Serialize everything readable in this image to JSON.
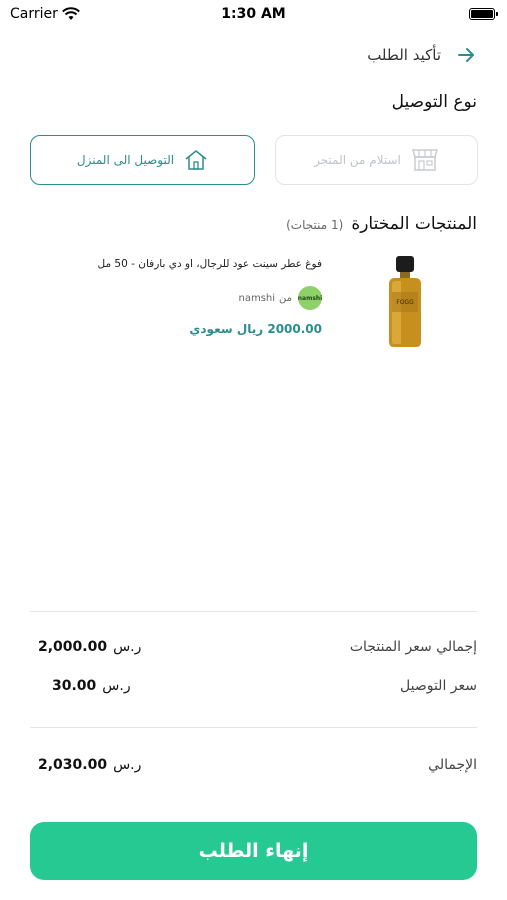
{
  "status_bar": {
    "carrier": "Carrier",
    "time": "1:30 AM"
  },
  "header": {
    "title": "تأكيد الطلب",
    "back_icon": "arrow-right-icon"
  },
  "delivery": {
    "title": "نوع التوصيل",
    "options": [
      {
        "label": "استلام من المتجر",
        "icon": "store-icon",
        "selected": false
      },
      {
        "label": "التوصيل الى المنزل",
        "icon": "home-icon",
        "selected": true
      }
    ]
  },
  "products": {
    "title": "المنتجات المختارة",
    "count": "(1 منتجات)",
    "items": [
      {
        "name": "فوغ عطر سينت عود للرجال، او دي بارفان - 50 مل",
        "store_from": "من",
        "store_name": "namshi",
        "store_logo_text": "namshi",
        "price": "2000.00 ريال سعودي",
        "image_label": "FOGG"
      }
    ]
  },
  "summary": {
    "products_total_label": "إجمالي سعر المنتجات",
    "products_total_value": "2,000.00",
    "delivery_label": "سعر التوصيل",
    "delivery_value": "30.00",
    "total_label": "الإجمالي",
    "total_value": "2,030.00",
    "currency": "ر.س"
  },
  "finish_button": {
    "label": "إنهاء الطلب"
  },
  "colors": {
    "accent": "#2b8d8d",
    "button": "#27c992",
    "divider": "#e3e5e8"
  }
}
